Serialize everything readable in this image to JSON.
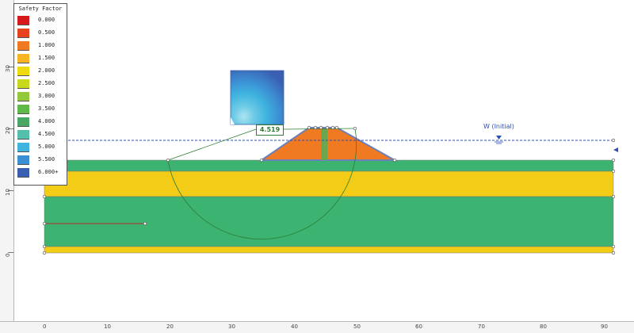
{
  "legend": {
    "title": "Safety Factor",
    "entries": [
      {
        "label": "0.000",
        "color": "#d7191c"
      },
      {
        "label": "0.500",
        "color": "#e8431f"
      },
      {
        "label": "1.000",
        "color": "#f07a22"
      },
      {
        "label": "1.500",
        "color": "#f7b524"
      },
      {
        "label": "2.000",
        "color": "#f0d90f"
      },
      {
        "label": "2.500",
        "color": "#c8d81d"
      },
      {
        "label": "3.000",
        "color": "#93c83a"
      },
      {
        "label": "3.500",
        "color": "#5eb84a"
      },
      {
        "label": "4.000",
        "color": "#4aa867"
      },
      {
        "label": "4.500",
        "color": "#55bfae"
      },
      {
        "label": "5.000",
        "color": "#3fb4df"
      },
      {
        "label": "5.500",
        "color": "#3c8fd3"
      },
      {
        "label": "6.000+",
        "color": "#3a5fb0"
      }
    ]
  },
  "factor_of_safety": "4.519",
  "water_table_label": "W (Initial)",
  "axes": {
    "x_ticks": [
      "0",
      "10",
      "20",
      "30",
      "40",
      "50",
      "60",
      "70",
      "80",
      "90"
    ],
    "y_ticks": [
      "0",
      "10",
      "20",
      "30"
    ]
  },
  "colors": {
    "yellow_layer": "#f2cc16",
    "green_layer": "#3cb371",
    "embankment": "#f07a22",
    "water_line": "#2f4fb5",
    "slip_circle": "#2e7d32"
  }
}
